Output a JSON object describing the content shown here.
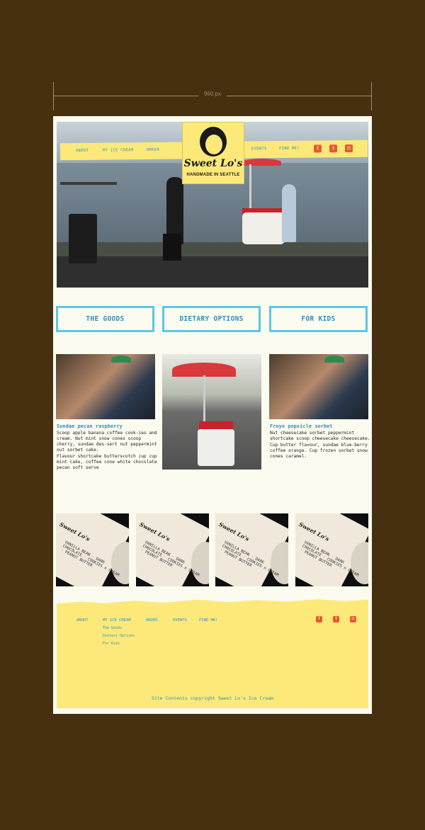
{
  "canvas": {
    "width_label": "960 px"
  },
  "header": {
    "nav_left": [
      "ABOUT",
      "MY ICE CREAM",
      "ORDER"
    ],
    "nav_right": [
      "EVENTS",
      "FIND ME!"
    ],
    "logo": {
      "name": "Sweet Lo's",
      "tagline": "HANDMADE IN SEATTLE"
    },
    "social": [
      "facebook-icon",
      "twitter-icon",
      "instagram-icon"
    ]
  },
  "buttons": [
    "THE GOODS",
    "DIETARY OPTIONS",
    "FOR KIDS"
  ],
  "cards": [
    {
      "title": "Sundae pecan raspberry",
      "body1": "Scoop apple banana coffee cook-ies and cream. Nut mint snow cones scoop cherry, sundae des-sert nut peppermint nut sorbet cake.",
      "body2": "Flavour shortcake butterscotch cup cup mint cake, coffee cone white chocolate pecan soft serve"
    },
    {
      "title": "Froyo popsicle sorbet",
      "body1": "Nut cheesecake sorbet peppermint shortcake scoop cheesecake cheesecake.",
      "body2": "Cup butter flavour, sundae blue-berry coffee orange. Cup frozen sorbet snow cones caramel."
    }
  ],
  "tiles": [
    {
      "brand": "Sweet Lo's",
      "lines": "VANILLA BEAN · DARK CHOCOLATE · COOKIES n CREAM · PEANUT BUTTER"
    },
    {
      "brand": "Sweet Lo's",
      "lines": "VANILLA BEAN · DARK CHOCOLATE · COOKIES n CREAM · PEANUT BUTTER"
    },
    {
      "brand": "Sweet Lo's",
      "lines": "VANILLA BEAN · DARK CHOCOLATE · COOKIES n CREAM · PEANUT BUTTER"
    },
    {
      "brand": "Sweet Lo's",
      "lines": "VANILLA BEAN · DARK CHOCOLATE · COOKIES n CREAM · PEANUT BUTTER"
    }
  ],
  "footer": {
    "about": "ABOUT",
    "my_ice_cream": "MY ICE CREAM",
    "sub": [
      "The Goods",
      "Dietary Options",
      "For Kids"
    ],
    "order": "ORDER",
    "events": "EVENTS",
    "find_me": "FIND ME!",
    "copyright": "Site Contents copyright Sweet Lo's Ice Cream"
  },
  "colors": {
    "background": "#47300f",
    "yellow": "#fde97a",
    "blue": "#2a93bf",
    "button_border": "#5cc7e6",
    "social": "#e45a36"
  }
}
